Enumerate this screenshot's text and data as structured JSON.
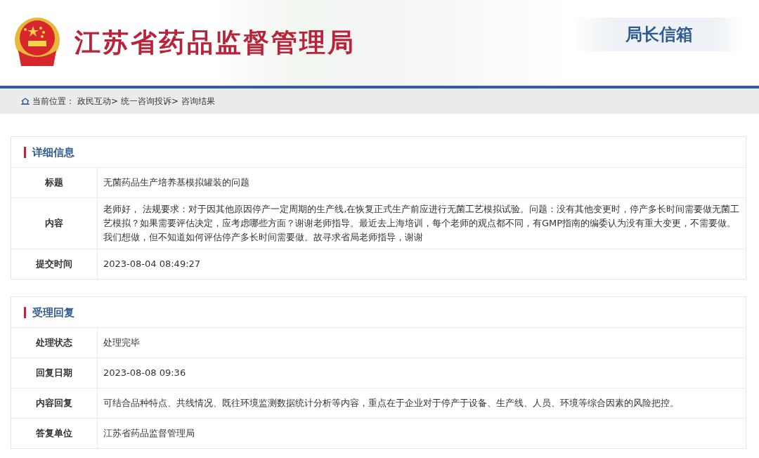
{
  "header": {
    "site_title": "江苏省药品监督管理局",
    "section_title": "局长信箱"
  },
  "breadcrumb": {
    "label": "当前位置：",
    "items": [
      "政民互动>",
      "统一咨询投诉>",
      "咨询结果"
    ]
  },
  "sections": [
    {
      "title": "详细信息",
      "rows": [
        {
          "label": "标题",
          "value": "无菌药品生产培养基模拟罐装的问题"
        },
        {
          "label": "内容",
          "value": "老师好， 法规要求：对于因其他原因停产一定周期的生产线,在恢复正式生产前应进行无菌工艺模拟试验。问题：没有其他变更时，停产多长时间需要做无菌工艺模拟？如果需要评估决定，应考虑哪些方面？谢谢老师指导。最近去上海培训，每个老师的观点都不同，有GMP指南的编委认为没有重大变更，不需要做。我们想做，但不知道如何评估停产多长时间需要做。故寻求省局老师指导，谢谢"
        },
        {
          "label": "提交时间",
          "value": "2023-08-04 08:49:27"
        }
      ]
    },
    {
      "title": "受理回复",
      "rows": [
        {
          "label": "处理状态",
          "value": "处理完毕"
        },
        {
          "label": "回复日期",
          "value": "2023-08-08 09:36"
        },
        {
          "label": "内容回复",
          "value": "可结合品种特点、共线情况、既往环境监测数据统计分析等内容，重点在于企业对于停产于设备、生产线、人员、环境等综合因素的风险把控。"
        },
        {
          "label": "答复单位",
          "value": "江苏省药品监督管理局"
        }
      ]
    }
  ]
}
